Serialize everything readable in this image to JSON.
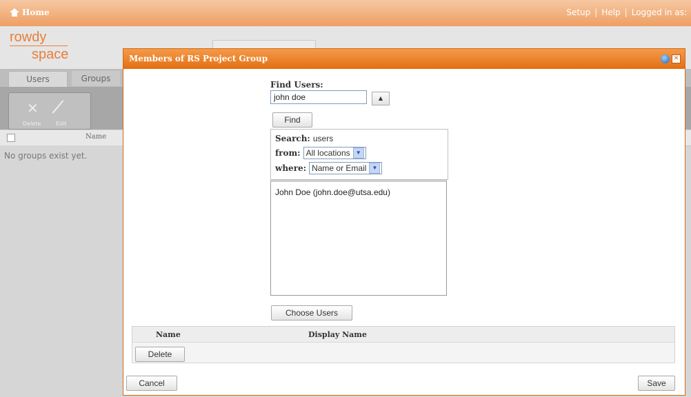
{
  "header": {
    "home_label": "Home",
    "links": [
      "Setup",
      "Help",
      "Logged in as:"
    ],
    "separator": "|"
  },
  "brand": {
    "line1": "rowdy",
    "line2": "space",
    "color": "#e87e3a"
  },
  "tabs": [
    {
      "label": "Users"
    },
    {
      "label": "Groups"
    }
  ],
  "toolbar": {
    "delete_label": "Delete",
    "edit_label": "Edit"
  },
  "groups_grid": {
    "column_name": "Name",
    "empty_message": "No groups exist yet."
  },
  "dialog": {
    "title": "Members of RS Project Group",
    "accent": "#e36f12",
    "find_users_label": "Find Users:",
    "find_users_value": "john doe",
    "spinner_glyph": "▲",
    "find_button": "Find",
    "search": {
      "search_label": "Search:",
      "search_value": "users",
      "from_label": "from:",
      "from_value": "All locations",
      "where_label": "where:",
      "where_value": "Name or Email",
      "dropdown_glyph": "▼"
    },
    "results": [
      "John Doe (john.doe@utsa.edu)"
    ],
    "choose_users_button": "Choose Users",
    "members_table": {
      "col_name": "Name",
      "col_display_name": "Display Name",
      "delete_button": "Delete"
    },
    "cancel_button": "Cancel",
    "save_button": "Save"
  }
}
